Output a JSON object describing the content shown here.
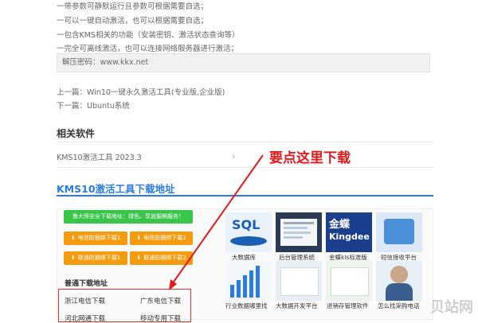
{
  "features": [
    "一带参数可静默运行且参数可根据需要自选；",
    "一可以一键自动激活，也可以根据需要自选；",
    "一包含KMS相关的功能（安装密钥、激活状态查询等）",
    "一完全可离线激活，也可以连接网络服务器进行激活；"
  ],
  "password_line": "解压密码：www.kkx.net",
  "prev_link": "上一篇：Win10一键永久激活工具(专业版,企业版)",
  "next_link": "下一篇：Ubuntu系统",
  "related": {
    "title": "相关软件",
    "item": "KMS10激活工具 2023.3",
    "chevron_icon": "chevron-right-icon"
  },
  "download_section": {
    "title": "KMS10激活工具下载地址",
    "accent_color": "#2a7ce0",
    "green_banner": "鲁大师安全下载地址：绿色、享放服稿服务！",
    "orange_buttons": [
      "电信防捆绑下载1",
      "电信防捆绑下载2",
      "联通防捆绑下载1",
      "联通防捆绑下载2"
    ],
    "button_color": "#f49b10",
    "normal_title": "普通下载地址",
    "normal_links": [
      "浙江电信下载",
      "广东电信下载",
      "河北网通下载",
      "移动专用下载"
    ]
  },
  "ads": {
    "row1": [
      "大数据库",
      "后台管理系统",
      "金蝶kis标准版",
      "短信接收平台"
    ],
    "row2": [
      "行业数据哪里找",
      "大数据开发平台",
      "进销存管理软件",
      "怎么找采购电话"
    ],
    "tile_texts": {
      "sql": "SQL",
      "kingdee_cn": "金蝶",
      "kingdee_en": "Kingdee"
    }
  },
  "annotation": "要点这里下载",
  "annotation_color": "#e31a1a",
  "watermark": "贝站网"
}
